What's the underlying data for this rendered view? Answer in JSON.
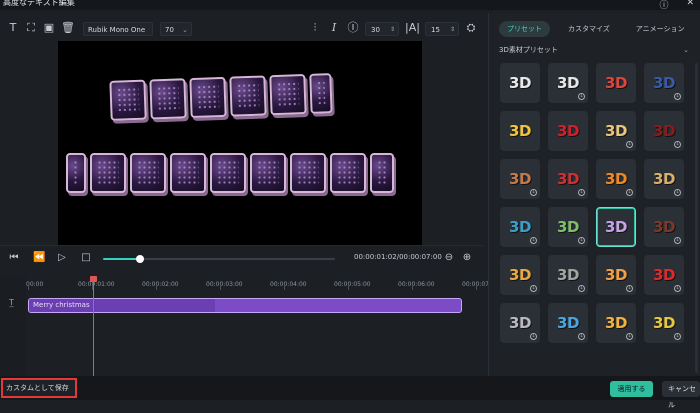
{
  "window": {
    "title": "高度なテキスト編集",
    "help_icon": "help-icon",
    "close_icon": "close-icon"
  },
  "toolbar": {
    "font_name": "Rubik Mono One F",
    "font_size": "70",
    "letter_spacing": "30",
    "line_spacing": "15"
  },
  "player": {
    "timecode": "00:00:01:02/00:00:07:00",
    "progress": 0.16
  },
  "timeline": {
    "ticks": [
      "00:00",
      "00:00:01:00",
      "00:00:02:00",
      "00:00:03:00",
      "00:00:04:00",
      "00:00:05:00",
      "00:00:06:00",
      "00:00:07:0"
    ],
    "clip_label": "Merry christmas"
  },
  "panel": {
    "tabs": [
      "プリセット",
      "カスタマイズ",
      "アニメーション"
    ],
    "active_tab": 0,
    "preset_category": "3D素材プリセット",
    "tile_label": "3D",
    "tiles": [
      {
        "color": "#e8e8ea",
        "dl": false
      },
      {
        "color": "#e6e6e6",
        "dl": true
      },
      {
        "color": "#e0453a",
        "dl": false
      },
      {
        "color": "#3b5aa6",
        "dl": true
      },
      {
        "color": "#f0c53a",
        "dl": false
      },
      {
        "color": "#d0202a",
        "dl": false
      },
      {
        "color": "#e8c77a",
        "dl": true
      },
      {
        "color": "#8a1c1c",
        "dl": true
      },
      {
        "color": "#c47a4a",
        "dl": true
      },
      {
        "color": "#d23030",
        "dl": true
      },
      {
        "color": "#f08a20",
        "dl": true
      },
      {
        "color": "#d9b06a",
        "dl": true
      },
      {
        "color": "#3aa0c8",
        "dl": true
      },
      {
        "color": "#7fbf6a",
        "dl": true
      },
      {
        "color": "#c6a2e6",
        "dl": false
      },
      {
        "color": "#7a3a2a",
        "dl": true
      },
      {
        "color": "#e8a940",
        "dl": true
      },
      {
        "color": "#9ea6a0",
        "dl": true
      },
      {
        "color": "#f0a040",
        "dl": true
      },
      {
        "color": "#e02a2a",
        "dl": true
      },
      {
        "color": "#b9b9c0",
        "dl": true
      },
      {
        "color": "#4aa6e0",
        "dl": true
      },
      {
        "color": "#f3b23a",
        "dl": true
      },
      {
        "color": "#e6c83a",
        "dl": true
      }
    ],
    "selected_tile": 14
  },
  "buttons": {
    "custom_save": "カスタムとして保存",
    "apply": "適用する",
    "cancel": "キャンセル"
  }
}
